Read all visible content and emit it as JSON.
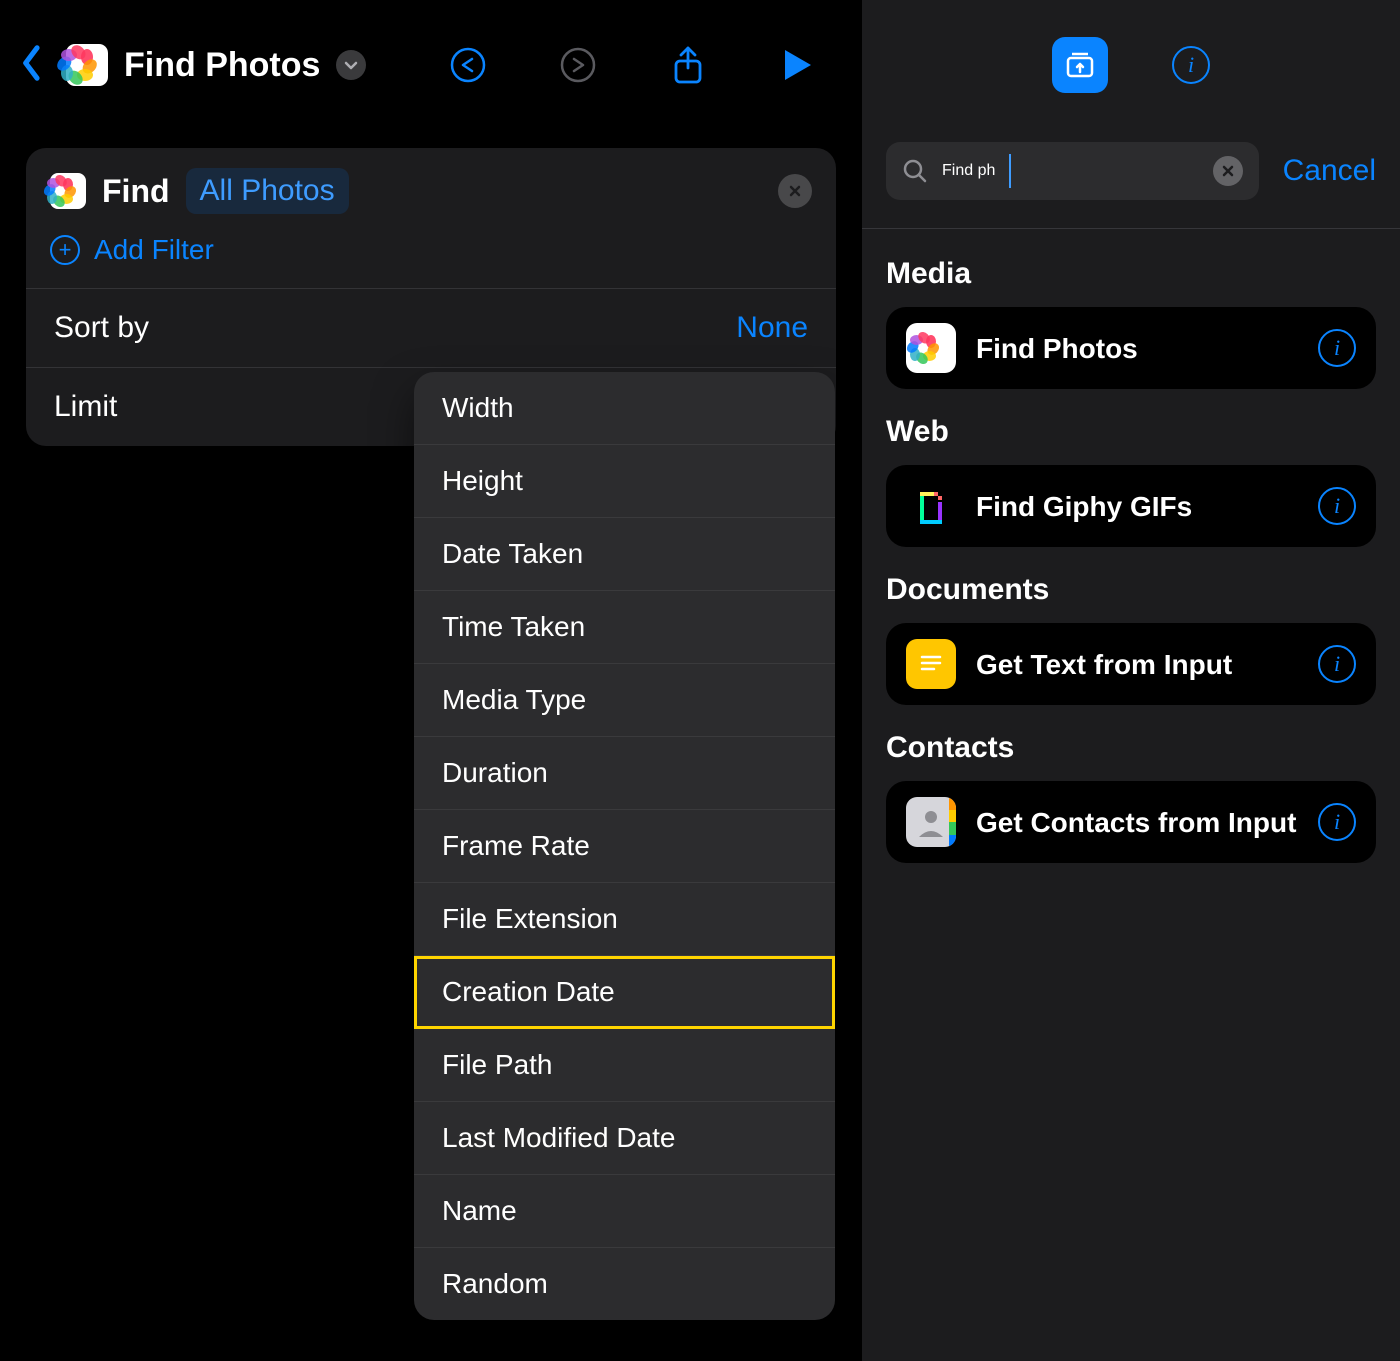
{
  "left": {
    "title": "Find Photos",
    "card": {
      "find_label": "Find",
      "scope_pill": "All Photos",
      "add_filter": "Add Filter",
      "sort_label": "Sort by",
      "sort_value": "None",
      "limit_label": "Limit"
    },
    "dropdown": [
      "Width",
      "Height",
      "Date Taken",
      "Time Taken",
      "Media Type",
      "Duration",
      "Frame Rate",
      "File Extension",
      "Creation Date",
      "File Path",
      "Last Modified Date",
      "Name",
      "Random"
    ],
    "dropdown_highlight_index": 8
  },
  "right": {
    "search_value": "Find ph",
    "cancel": "Cancel",
    "sections": [
      {
        "title": "Media",
        "items": [
          {
            "label": "Find Photos",
            "icon": "photos"
          }
        ]
      },
      {
        "title": "Web",
        "items": [
          {
            "label": "Find Giphy GIFs",
            "icon": "giphy"
          }
        ]
      },
      {
        "title": "Documents",
        "items": [
          {
            "label": "Get Text from Input",
            "icon": "text"
          }
        ]
      },
      {
        "title": "Contacts",
        "items": [
          {
            "label": "Get Contacts from Input",
            "icon": "contacts"
          }
        ]
      }
    ]
  },
  "colors": {
    "accent_blue": "#0a84ff",
    "highlight": "#ffd500"
  }
}
